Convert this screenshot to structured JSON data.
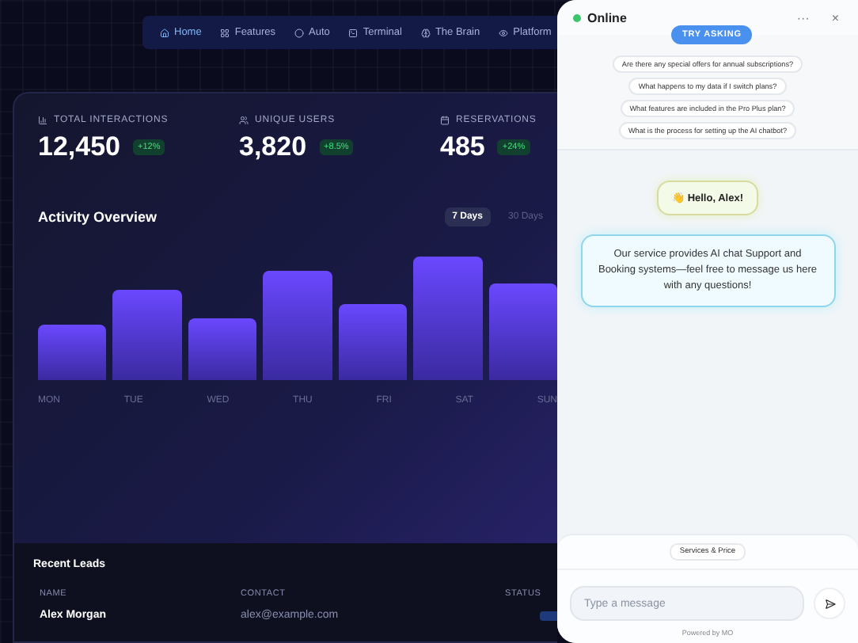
{
  "nav": [
    {
      "label": "Home",
      "selected": true
    },
    {
      "label": "Features",
      "selected": false
    },
    {
      "label": "Auto",
      "selected": false
    },
    {
      "label": "Terminal",
      "selected": false
    },
    {
      "label": "The Brain",
      "selected": false
    },
    {
      "label": "Platform",
      "selected": false
    }
  ],
  "stats": [
    {
      "label": "TOTAL INTERACTIONS",
      "value": "12,450",
      "change": "+12%"
    },
    {
      "label": "UNIQUE USERS",
      "value": "3,820",
      "change": "+8.5%"
    },
    {
      "label": "RESERVATIONS",
      "value": "485",
      "change": "+24%"
    }
  ],
  "activity": {
    "title": "Activity Overview",
    "ranges": [
      {
        "label": "7 Days",
        "selected": true
      },
      {
        "label": "30 Days",
        "selected": false
      }
    ],
    "days": [
      "MON",
      "TUE",
      "WED",
      "THU",
      "FRI",
      "SAT",
      "SUN"
    ]
  },
  "leads": {
    "title": "Recent Leads",
    "columns": [
      "NAME",
      "CONTACT",
      "STATUS"
    ],
    "rows": [
      {
        "name": "Alex Morgan",
        "contact": "alex@example.com"
      }
    ]
  },
  "chat": {
    "status": "Online",
    "online": true,
    "more": "···",
    "close": "×",
    "badge": "TRY ASKING",
    "suggestions": [
      "Are there any special offers for annual subscriptions?",
      "What happens to my data if I switch plans?",
      "What features are included in the Pro Plus plan?",
      "What is the process for setting up the AI chatbot?"
    ],
    "greeting": "👋 Hello, Alex!",
    "message": "Our service provides AI chat Support and Booking systems—feel free to message us here with any questions!",
    "quick_reply": "Services & Price",
    "input": {
      "placeholder": "Type a message"
    },
    "footer": "Powered by MO"
  }
}
